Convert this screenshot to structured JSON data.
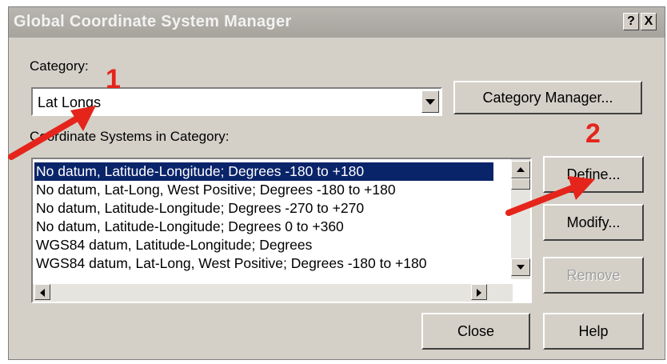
{
  "window": {
    "title": "Global Coordinate System Manager",
    "help_glyph": "?",
    "close_glyph": "X"
  },
  "category": {
    "label": "Category:",
    "selected": "Lat Longs",
    "manager_button": "Category Manager..."
  },
  "systems": {
    "label": "Coordinate Systems in Category:",
    "items": [
      "No datum, Latitude-Longitude; Degrees -180 to +180",
      "No datum, Lat-Long, West Positive; Degrees -180 to +180",
      "No datum, Latitude-Longitude; Degrees -270 to +270",
      "No datum, Latitude-Longitude; Degrees 0 to +360",
      "WGS84 datum, Latitude-Longitude; Degrees",
      "WGS84 datum, Lat-Long, West Positive; Degrees -180 to +180"
    ],
    "selected_index": 0
  },
  "buttons": {
    "define": "Define...",
    "modify": "Modify...",
    "remove": "Remove",
    "close": "Close",
    "help": "Help"
  },
  "annotations": {
    "step1": "1",
    "step2": "2",
    "arrow_color": "#e5251b"
  },
  "colors": {
    "dialog_bg": "#d4d0c8",
    "selection_bg": "#0a246a",
    "selection_text": "#ffffff"
  }
}
